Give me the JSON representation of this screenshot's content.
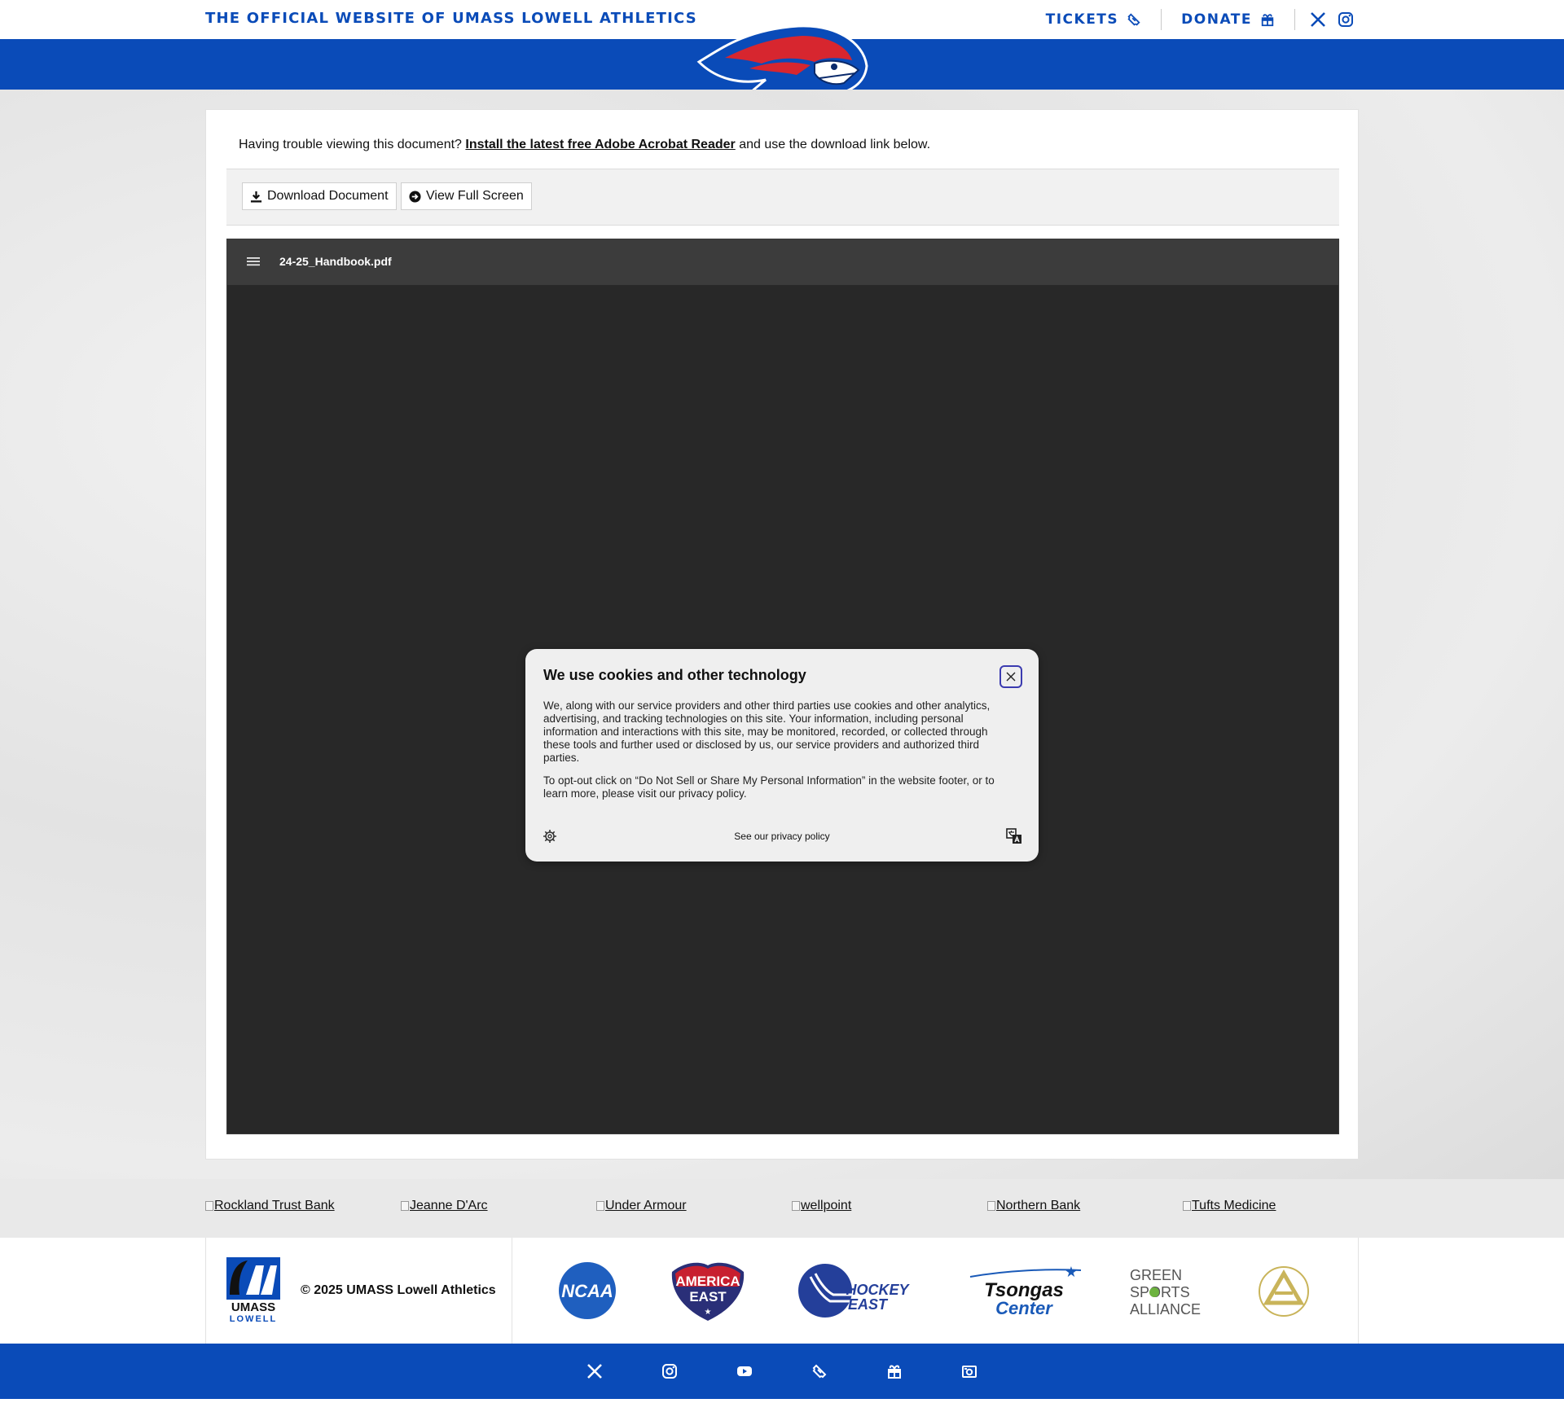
{
  "header": {
    "site_title": "THE OFFICIAL WEBSITE OF UMASS LOWELL ATHLETICS",
    "tickets_label": "TICKETS",
    "donate_label": "DONATE",
    "social": [
      "x-icon",
      "instagram-icon"
    ]
  },
  "colors": {
    "primary_blue": "#0a4bb8",
    "accent_red": "#d7262f",
    "viewer_bg": "#282828"
  },
  "document": {
    "trouble_prefix": "Having trouble viewing this document?",
    "trouble_link": "Install the latest free Adobe Acrobat Reader",
    "trouble_suffix": "and use the download link below.",
    "download_label": "Download Document",
    "fullscreen_label": "View Full Screen",
    "file_name": "24-25_Handbook.pdf"
  },
  "cookie_dialog": {
    "title": "We use cookies and other technology",
    "paragraph1": "We, along with our service providers and other third parties use cookies and other analytics, advertising, and tracking technologies on this site. Your information, including personal information and interactions with this site, may be monitored, recorded, or collected through these tools and further used or disclosed by us, our service providers and authorized third parties.",
    "paragraph2": "To opt-out click on “Do Not Sell or Share My Personal Information” in the website footer, or to learn more, please visit our privacy policy.",
    "privacy_link": "See our privacy policy"
  },
  "sponsors": [
    "Rockland Trust Bank",
    "Jeanne D'Arc",
    "Under Armour",
    "wellpoint",
    "Northern Bank",
    "Tufts Medicine"
  ],
  "footer": {
    "umass_logo_text_1": "UMASS",
    "umass_logo_text_2": "LOWELL",
    "copyright": "© 2025 UMASS Lowell Athletics",
    "ncaa_text": "NCAA",
    "america_east_1": "AMERICA",
    "america_east_2": "EAST",
    "hockey_east_1": "HOCKEY",
    "hockey_east_2": "EAST",
    "tsongas_1": "Tsongas",
    "tsongas_2": "Center",
    "green_1": "GREEN",
    "green_2": "SPORTS",
    "green_3": "ALLIANCE"
  },
  "bottom_icons": [
    "x-icon",
    "instagram-icon",
    "youtube-icon",
    "ticket-icon",
    "gift-icon",
    "camera-icon"
  ]
}
